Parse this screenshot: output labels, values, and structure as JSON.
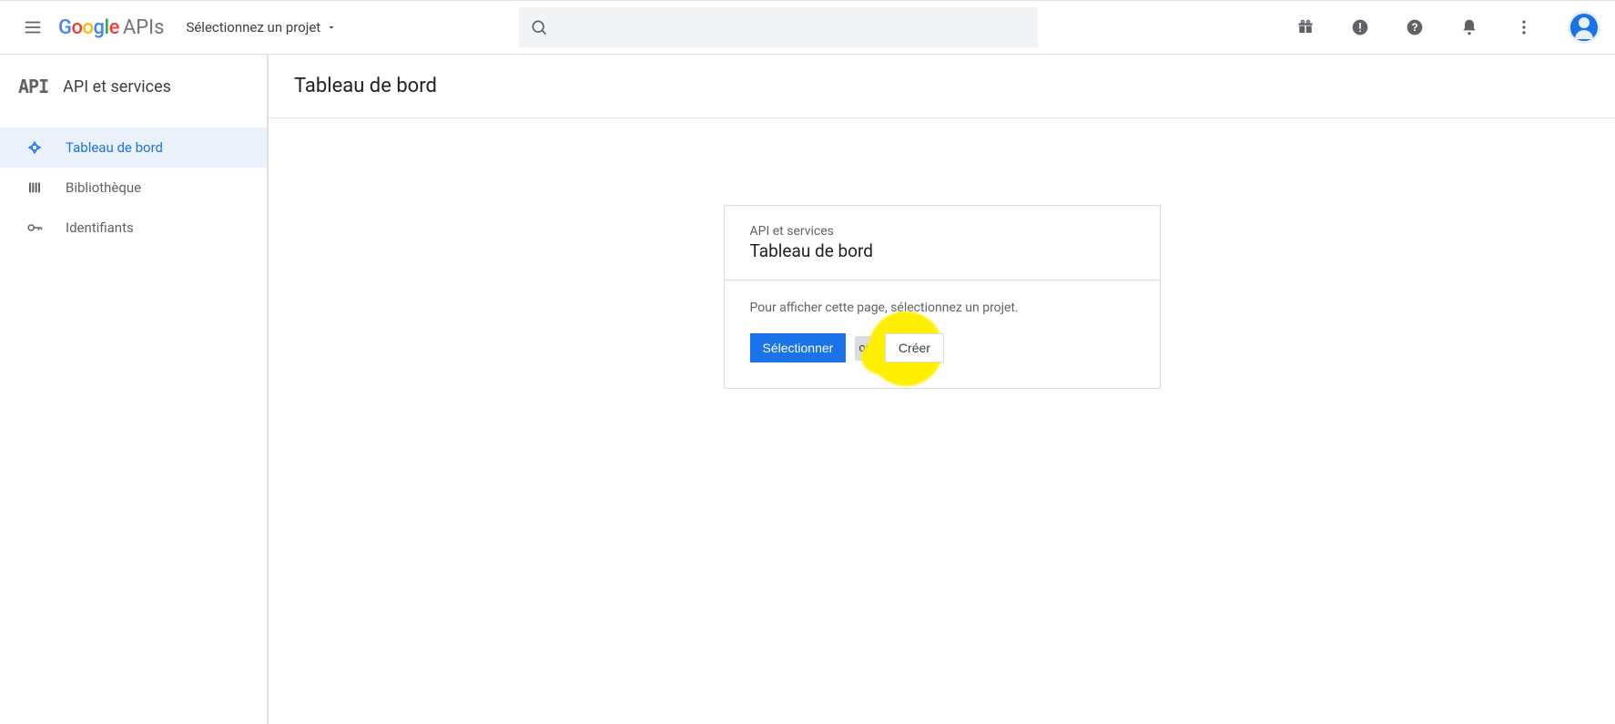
{
  "header": {
    "logo_suffix": "APIs",
    "project_selector_label": "Sélectionnez un projet"
  },
  "sidebar": {
    "section_title": "API et services",
    "items": [
      {
        "label": "Tableau de bord",
        "active": true
      },
      {
        "label": "Bibliothèque",
        "active": false
      },
      {
        "label": "Identifiants",
        "active": false
      }
    ]
  },
  "main": {
    "page_title": "Tableau de bord"
  },
  "card": {
    "subtitle": "API et services",
    "title": "Tableau de bord",
    "instruction": "Pour afficher cette page, sélectionnez un projet.",
    "select_button": "Sélectionner",
    "or_text": "ou",
    "create_button": "Créer"
  }
}
